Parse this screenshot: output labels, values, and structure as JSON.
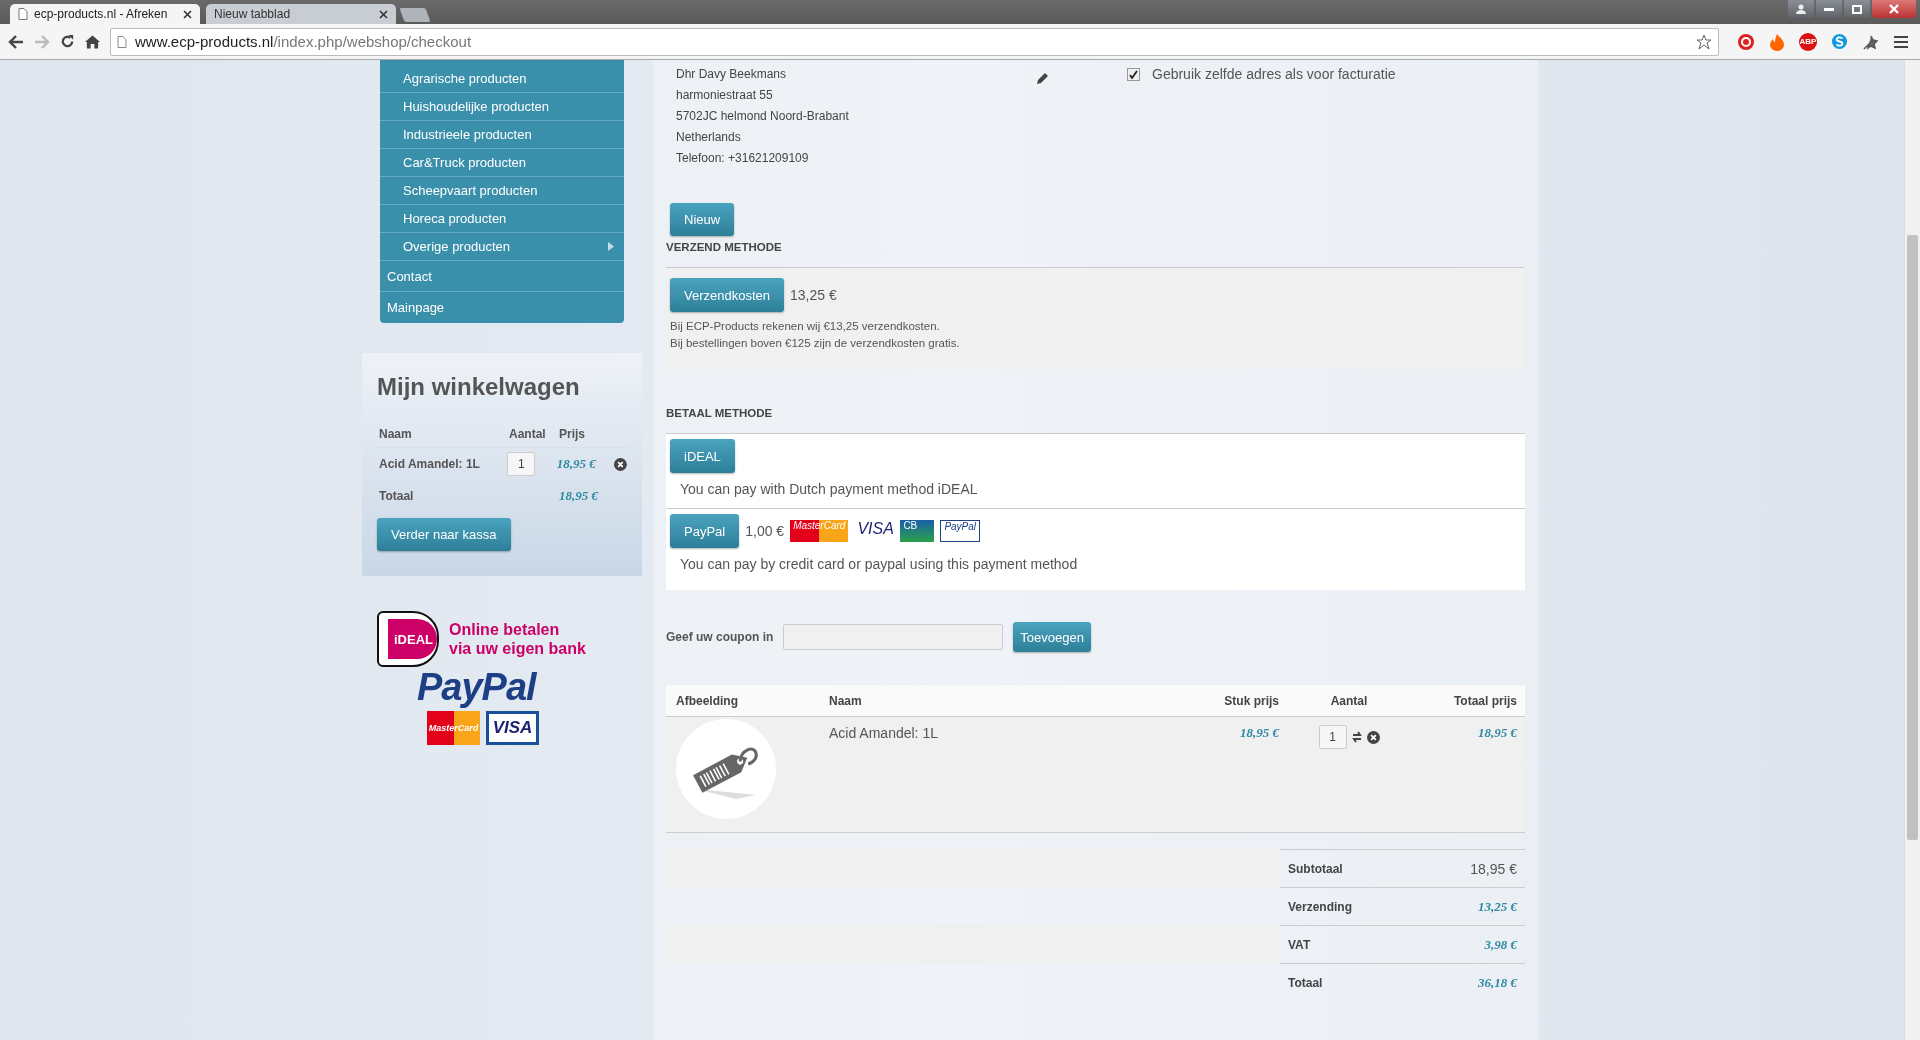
{
  "browser": {
    "tabs": [
      {
        "title": "ecp-products.nl - Afreken",
        "selected": true
      },
      {
        "title": "Nieuw tabblad",
        "selected": false
      }
    ],
    "url": {
      "host": "www.ecp-products.nl",
      "path": "/index.php/webshop/checkout"
    },
    "extension_label": "ABP"
  },
  "sidebar": {
    "menu": [
      {
        "label": "Agrarische producten",
        "kind": "sub",
        "has_submenu": false
      },
      {
        "label": "Huishoudelijke producten",
        "kind": "sub",
        "has_submenu": false
      },
      {
        "label": "Industrieele producten",
        "kind": "sub",
        "has_submenu": false
      },
      {
        "label": "Car&Truck producten",
        "kind": "sub",
        "has_submenu": false
      },
      {
        "label": "Scheepvaart producten",
        "kind": "sub",
        "has_submenu": false
      },
      {
        "label": "Horeca producten",
        "kind": "sub",
        "has_submenu": false
      },
      {
        "label": "Overige producten",
        "kind": "sub",
        "has_submenu": true
      },
      {
        "label": "Contact",
        "kind": "top",
        "has_submenu": false
      },
      {
        "label": "Mainpage",
        "kind": "top",
        "has_submenu": false
      }
    ],
    "cart": {
      "title": "Mijn winkelwagen",
      "columns": [
        "Naam",
        "Aantal",
        "Prijs"
      ],
      "items": [
        {
          "name": "Acid Amandel: 1L",
          "quantity": "1",
          "price": "18,95 €"
        }
      ],
      "total_label": "Totaal",
      "total_value": "18,95 €",
      "checkout_button": "Verder naar kassa"
    },
    "banner": {
      "ideal_logo": "iDEAL",
      "ideal_text": [
        "Online betalen",
        "via uw eigen bank"
      ],
      "paypal_logo": "PayPal",
      "cards": [
        "MasterCard",
        "VISA"
      ]
    }
  },
  "main": {
    "address": [
      "Dhr Davy Beekmans",
      "harmoniestraat 55",
      "5702JC helmond Noord-Brabant",
      "Netherlands",
      "Telefoon: +31621209109"
    ],
    "same_address": {
      "label": "Gebruik zelfde adres als voor facturatie",
      "checked": true
    },
    "new_button": "Nieuw",
    "shipping": {
      "heading": "VERZEND METHODE",
      "button": "Verzendkosten",
      "price": "13,25 €",
      "notes": [
        "Bij ECP-Products rekenen wij €13,25 verzendkosten.",
        "Bij bestellingen boven €125 zijn de verzendkosten gratis."
      ]
    },
    "payment": {
      "heading": "BETAAL METHODE",
      "methods": [
        {
          "button": "iDEAL",
          "description": "You can pay with Dutch payment method iDEAL"
        },
        {
          "button": "PayPal",
          "price": "1,00 €",
          "cards": [
            "MasterCard",
            "VISA",
            "CB",
            "PayPal"
          ],
          "description": "You can pay by credit card or paypal using this payment method"
        }
      ]
    },
    "coupon": {
      "label": "Geef uw coupon in",
      "button": "Toevoegen"
    },
    "table": {
      "columns": [
        "Afbeelding",
        "Naam",
        "Stuk prijs",
        "Aantal",
        "Totaal prijs"
      ],
      "rows": [
        {
          "name": "Acid Amandel: 1L",
          "unit_price": "18,95 €",
          "quantity": "1",
          "total": "18,95 €"
        }
      ]
    },
    "totals": [
      {
        "label": "Subtotaal",
        "value": "18,95 €",
        "kind": "plain"
      },
      {
        "label": "Verzending",
        "value": "13,25 €",
        "kind": "price"
      },
      {
        "label": "VAT",
        "value": "3,98 €",
        "kind": "price"
      },
      {
        "label": "Totaal",
        "value": "36,18 €",
        "kind": "price"
      }
    ]
  }
}
